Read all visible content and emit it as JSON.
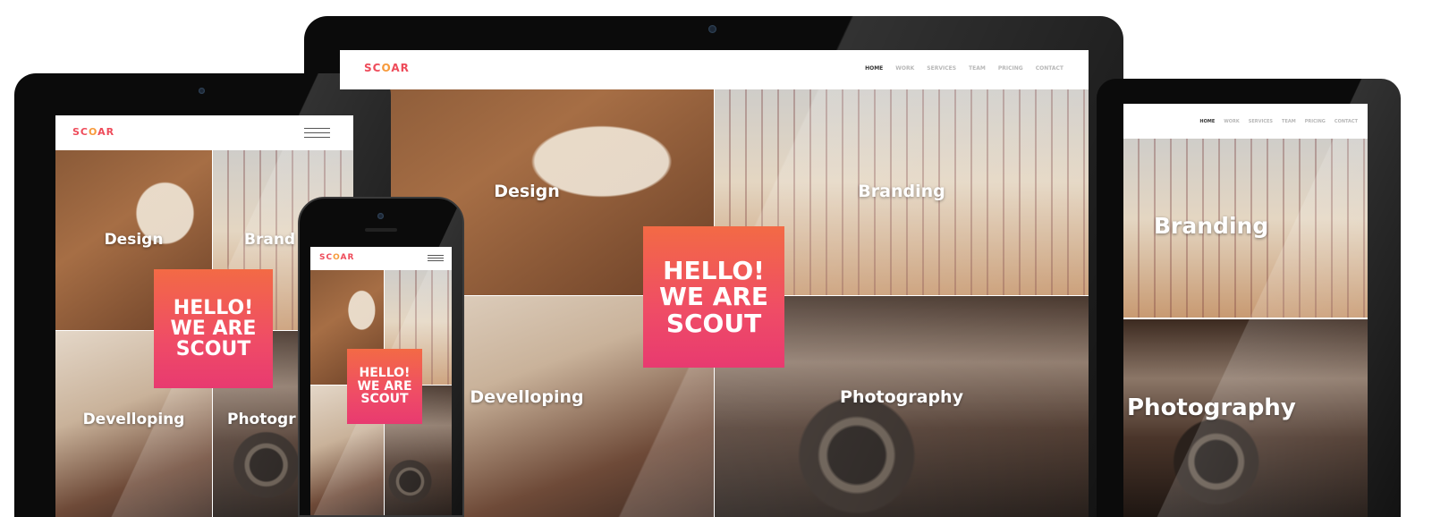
{
  "site": {
    "logo": {
      "letters_before": "SC",
      "accent_letter": "O",
      "letters_after": "AR"
    },
    "nav": [
      "HOME",
      "WORK",
      "SERVICES",
      "TEAM",
      "PRICING",
      "CONTACT"
    ],
    "hero_lines": [
      "HELLO!",
      "WE ARE",
      "SCOUT"
    ]
  },
  "tiles": {
    "design": "Design",
    "branding": "Branding",
    "developing": "Develloping",
    "photography": "Photography"
  },
  "tablet_partial_labels": {
    "branding": "Brand",
    "photography": "Photogr"
  },
  "colors": {
    "brand_red": "#ee4b5a",
    "brand_orange": "#f79a3a",
    "hero_gradient_top": "#f36a45",
    "hero_gradient_bottom": "#e83a70"
  }
}
